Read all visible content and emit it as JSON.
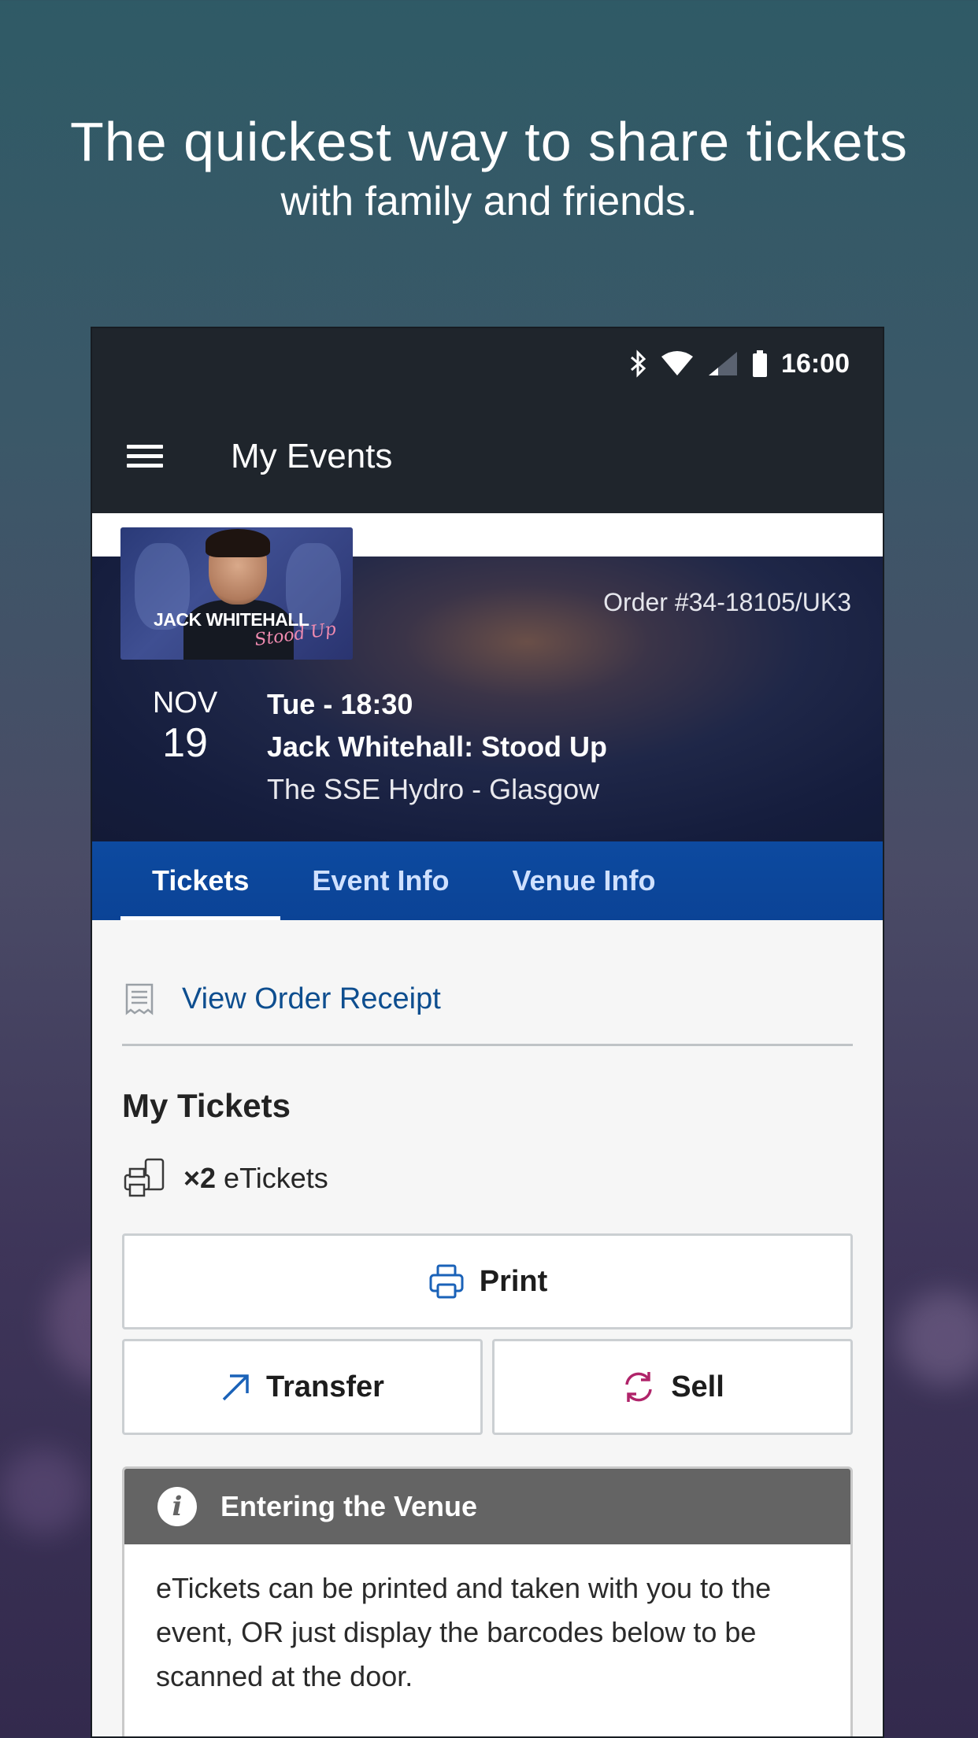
{
  "promo": {
    "headline": "The quickest way to share tickets",
    "subheadline": "with family and friends."
  },
  "statusbar": {
    "time": "16:00",
    "icons": [
      "bluetooth-icon",
      "wifi-icon",
      "signal-icon",
      "battery-icon"
    ]
  },
  "appbar": {
    "title": "My Events"
  },
  "event": {
    "thumbnail_text": "JACK WHITEHALL",
    "thumbnail_subtext": "Stood Up",
    "order": "Order #34-18105/UK3",
    "month": "NOV",
    "day": "19",
    "time": "Tue - 18:30",
    "name": "Jack Whitehall: Stood Up",
    "venue": "The SSE Hydro - Glasgow"
  },
  "tabs": [
    {
      "label": "Tickets",
      "active": true
    },
    {
      "label": "Event Info",
      "active": false
    },
    {
      "label": "Venue Info",
      "active": false
    }
  ],
  "receipt": {
    "label": "View Order Receipt"
  },
  "tickets": {
    "section_title": "My Tickets",
    "count_prefix": "×2",
    "count_label": "eTickets",
    "print_label": "Print",
    "transfer_label": "Transfer",
    "sell_label": "Sell"
  },
  "info_box": {
    "title": "Entering the Venue",
    "icon_glyph": "i",
    "body": "eTickets can be printed and taken with you to the event, OR just display the barcodes below to be scanned at the door."
  },
  "colors": {
    "tab_bar": "#0d4aa0",
    "link": "#0e4e8f",
    "transfer_icon": "#1a62b8",
    "sell_icon": "#b0246a",
    "appbar": "#1f252c"
  }
}
